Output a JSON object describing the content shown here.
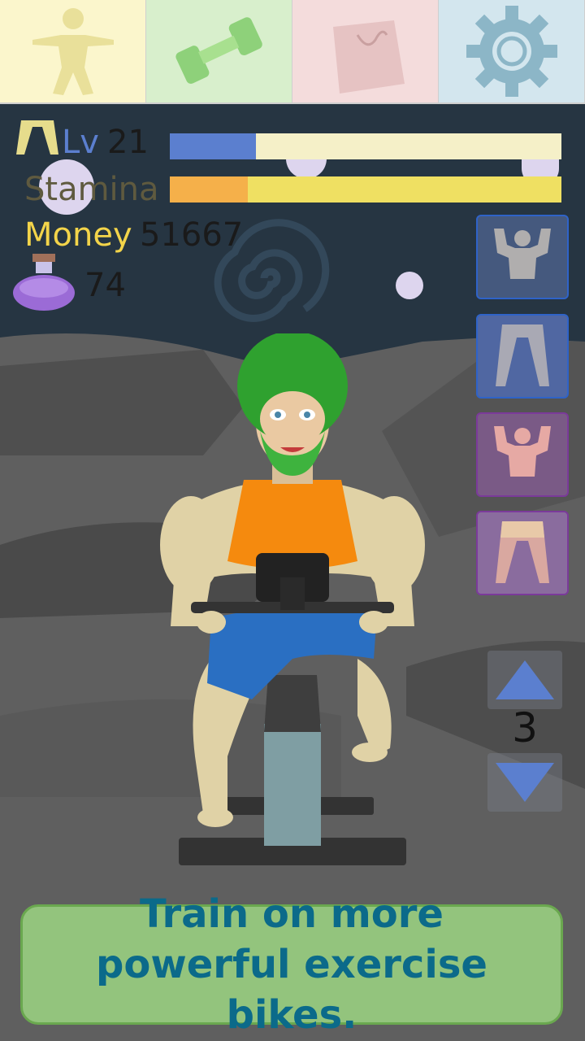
{
  "tabs": [
    {
      "name": "body",
      "icon": "body-figure-icon",
      "color": "#fbf6cc"
    },
    {
      "name": "training",
      "icon": "dumbbell-icon",
      "color": "#d8efcc"
    },
    {
      "name": "shop",
      "icon": "shopping-bag-icon",
      "color": "#f4dcdc"
    },
    {
      "name": "settings",
      "icon": "gear-icon",
      "color": "#d3e6ee"
    }
  ],
  "stats": {
    "level_label": "Lv",
    "level_value": "21",
    "level_progress": 0.22,
    "stamina_label": "Stamina",
    "stamina_progress": 0.2,
    "money_label": "Money",
    "money_value": "51667",
    "potion_value": "74"
  },
  "colors": {
    "level_bar_fill": "#5b7fcf",
    "level_bar_bg": "#f5f0c8",
    "stamina_bar_fill": "#f5b04a",
    "stamina_bar_bg": "#efe062",
    "money_label": "#f3d44a",
    "accent_caption_text": "#0b6a8a"
  },
  "side_buttons": [
    {
      "name": "upper-body-blue",
      "icon": "upper-body-icon"
    },
    {
      "name": "legs-blue",
      "icon": "legs-icon"
    },
    {
      "name": "upper-body-purple",
      "icon": "upper-body-icon"
    },
    {
      "name": "legs-purple",
      "icon": "legs-icon"
    }
  ],
  "bike_level": "3",
  "caption": "Train on more powerful exercise bikes."
}
